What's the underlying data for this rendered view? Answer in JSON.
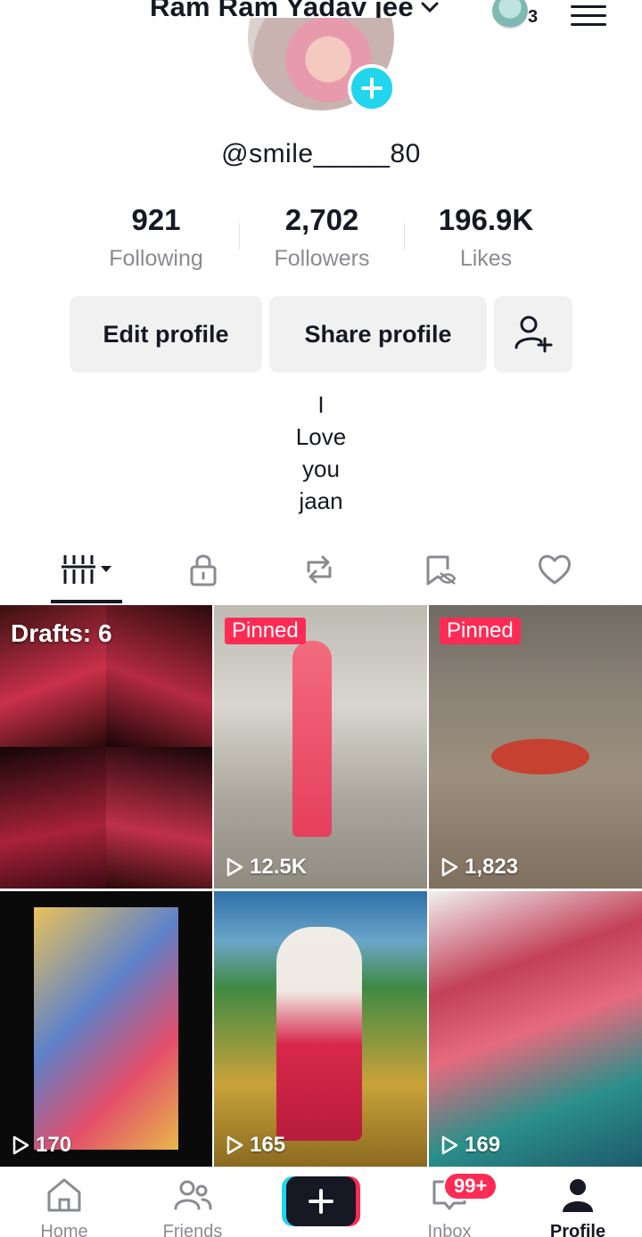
{
  "header": {
    "username": "Ram Ram Yadav jee",
    "account_count": "3",
    "menu_icon": "hamburger-menu-icon"
  },
  "profile": {
    "handle": "@smile_____80",
    "stats": [
      {
        "value": "921",
        "label": "Following"
      },
      {
        "value": "2,702",
        "label": "Followers"
      },
      {
        "value": "196.9K",
        "label": "Likes"
      }
    ],
    "edit_label": "Edit profile",
    "share_label": "Share profile",
    "bio_lines": [
      "I",
      "Love",
      "you",
      "jaan"
    ]
  },
  "tabs": [
    {
      "icon": "grid-videos-icon",
      "active": true
    },
    {
      "icon": "lock-icon"
    },
    {
      "icon": "repost-icon"
    },
    {
      "icon": "hidden-bookmark-icon"
    },
    {
      "icon": "heart-icon"
    }
  ],
  "grid": {
    "drafts_label": "Drafts: 6",
    "videos": [
      {
        "pinned": "Pinned",
        "views": "12.5K"
      },
      {
        "pinned": "Pinned",
        "views": "1,823"
      },
      {
        "views": "170"
      },
      {
        "views": "165"
      },
      {
        "views": "169"
      }
    ]
  },
  "nav": {
    "home": "Home",
    "friends": "Friends",
    "inbox": "Inbox",
    "inbox_badge": "99+",
    "profile": "Profile"
  },
  "colors": {
    "accent_red": "#fe2c55",
    "accent_cyan": "#20d5ec",
    "text_primary": "#161823",
    "text_secondary": "#8a8b91"
  }
}
